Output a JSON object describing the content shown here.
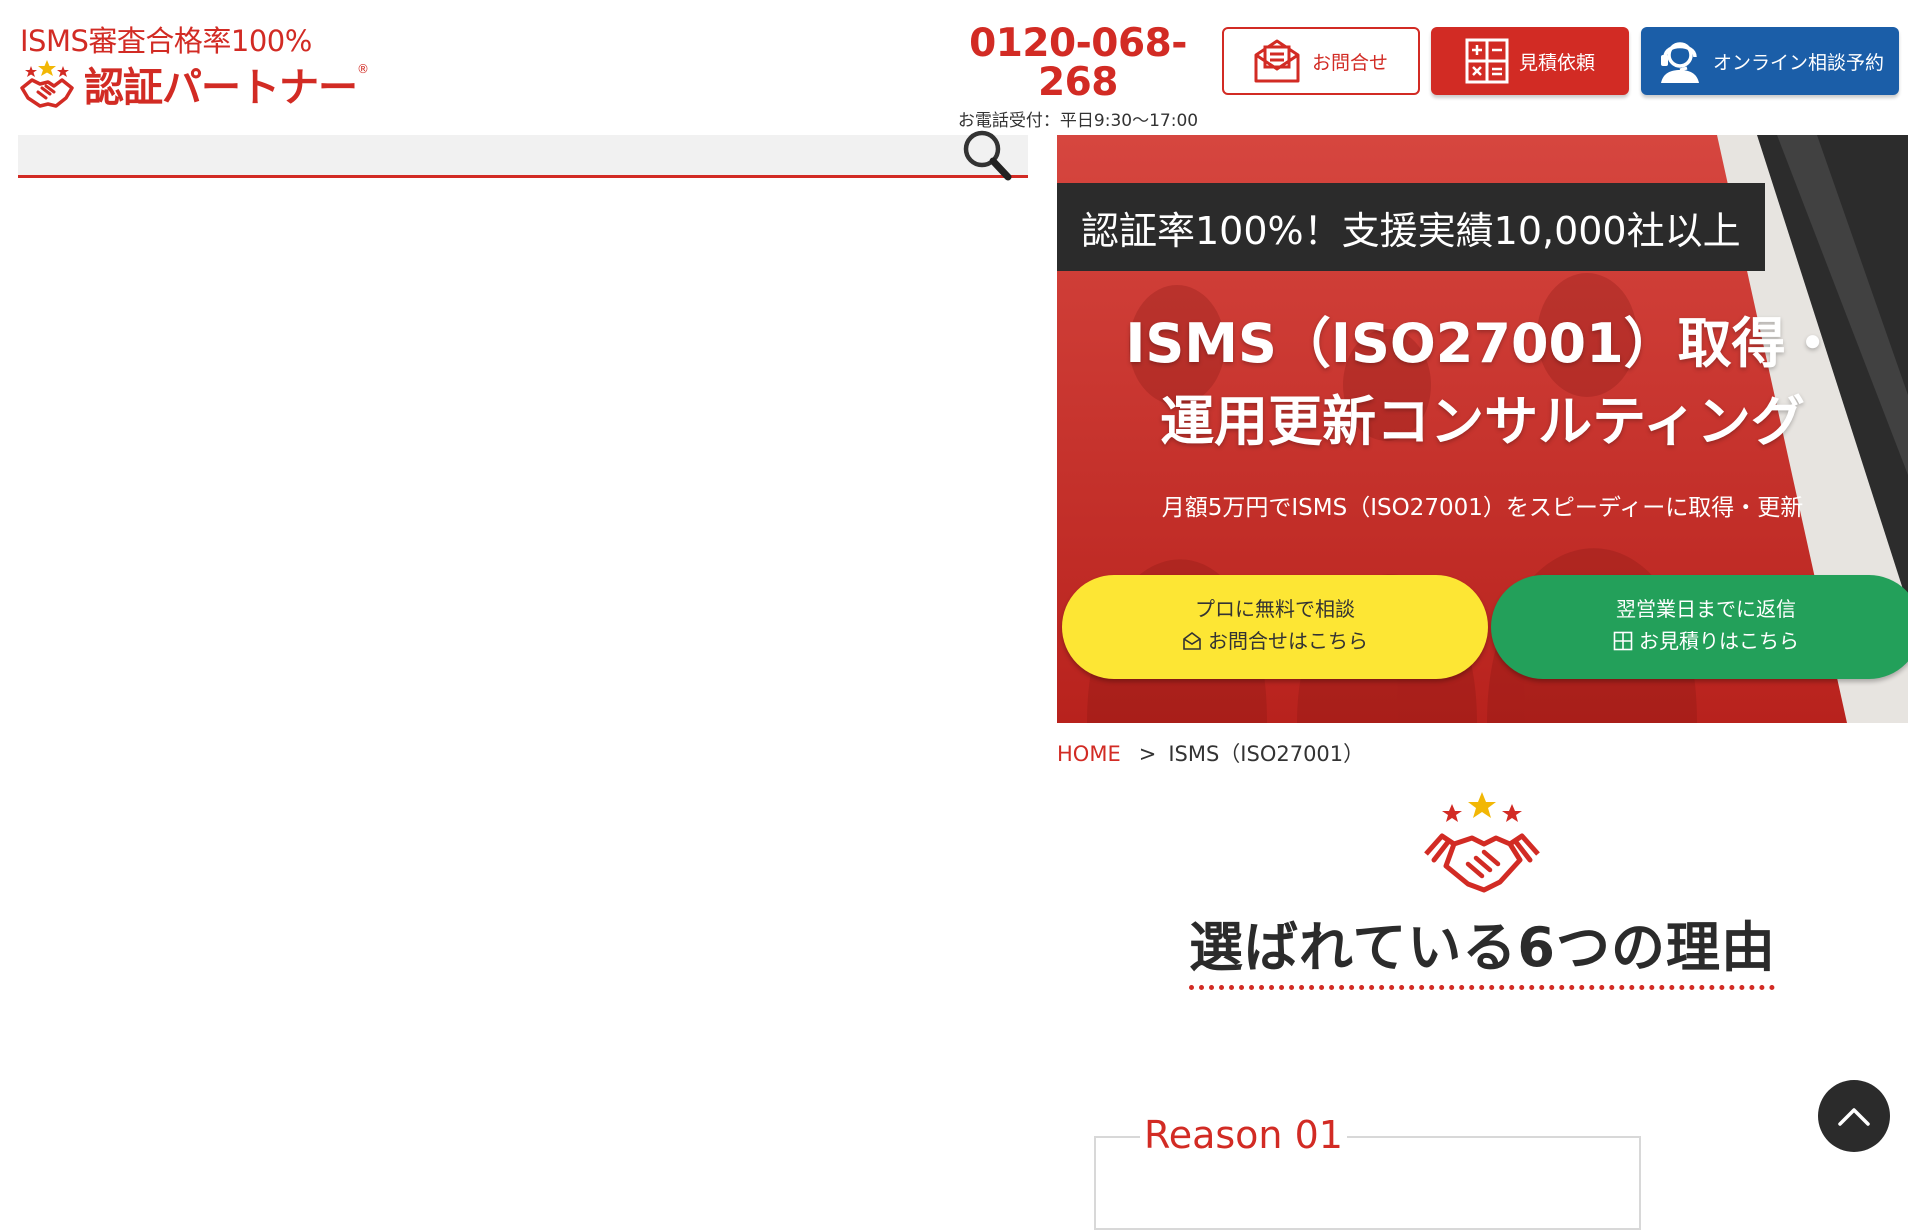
{
  "header": {
    "tagline": "ISMS審査合格率100%",
    "logo_text": "認証パートナー",
    "logo_reg": "®",
    "phone_number": "0120-068-268",
    "phone_hours": "お電話受付：平日9:30〜17:00",
    "buttons": {
      "contact": "お問合せ",
      "estimate": "見積依頼",
      "online": "オンライン相談予約"
    }
  },
  "search": {
    "placeholder": ""
  },
  "hero": {
    "badge": "認証率100%！支援実績10,000社以上",
    "title_line1": "ISMS（ISO27001）取得・",
    "title_line2": "運用更新コンサルティング",
    "subtitle": "月額5万円でISMS（ISO27001）をスピーディーに取得・更新",
    "cta_free": {
      "line1": "プロに無料で相談",
      "line2": "お問合せはこちら"
    },
    "cta_quote": {
      "line1": "翌営業日までに返信",
      "line2": "お見積りはこちら"
    }
  },
  "breadcrumb": {
    "home": "HOME",
    "separator": ">",
    "current": "ISMS（ISO27001）"
  },
  "section": {
    "title": "選ばれている6つの理由",
    "reason_label": "Reason 01"
  },
  "colors": {
    "brand_red": "#d22b24",
    "brand_blue": "#1b5ea8",
    "cta_yellow": "#fde634",
    "cta_green": "#23a05a",
    "dark": "#2b2b2b"
  }
}
